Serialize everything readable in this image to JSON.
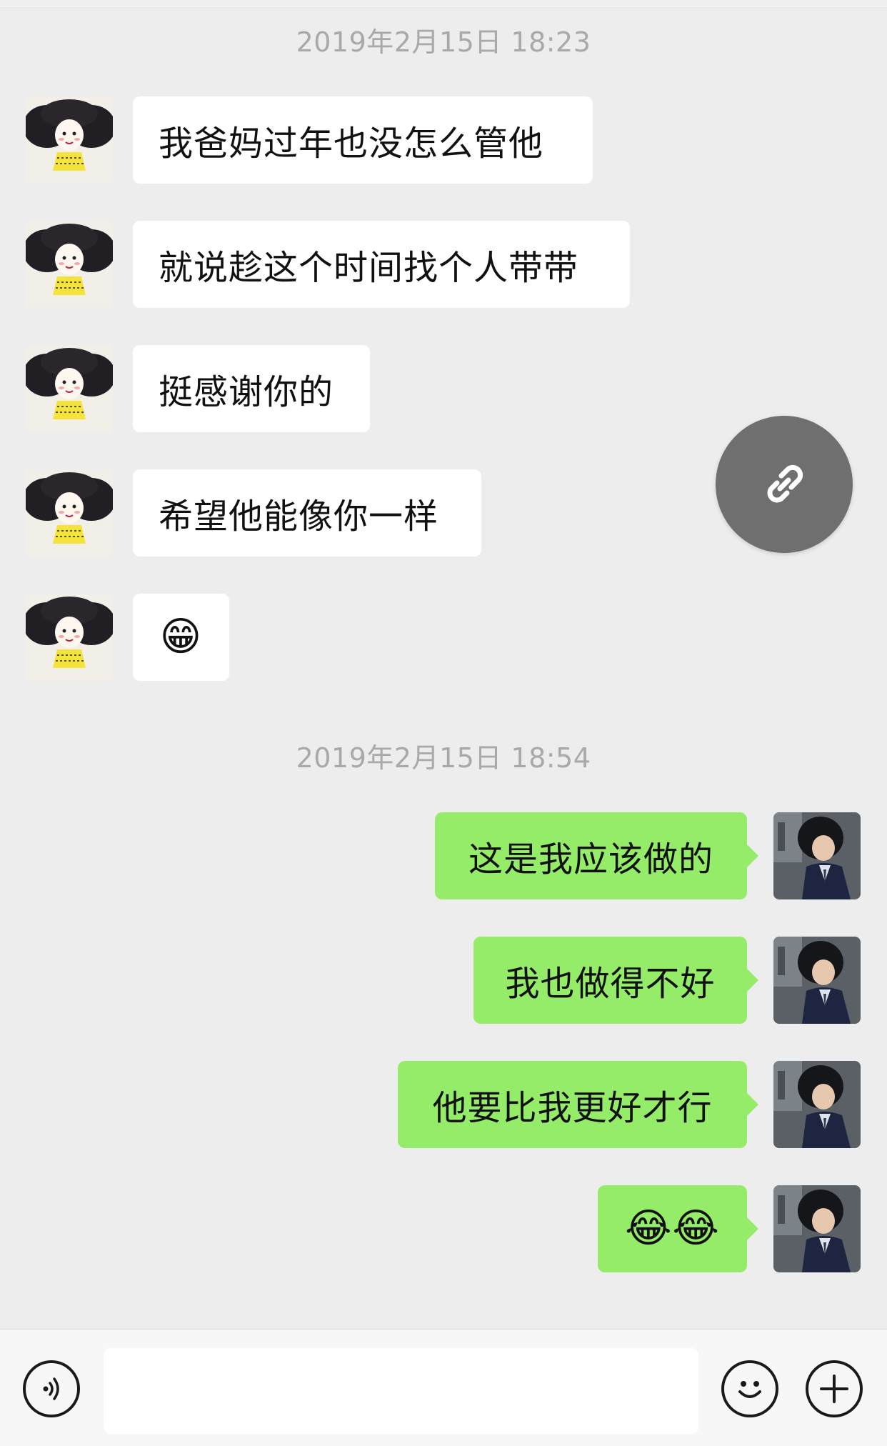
{
  "chat": {
    "timestamps": [
      "2019年2月15日 18:23",
      "2019年2月15日 18:54"
    ],
    "incoming": [
      "我爸妈过年也没怎么管他",
      "就说趁这个时间找个人带带",
      "挺感谢你的",
      "希望他能像你一样",
      "😁"
    ],
    "outgoing": [
      "这是我应该做的",
      "我也做得不好",
      "他要比我更好才行",
      "😂😂"
    ]
  },
  "floating": {
    "icon": "link-icon",
    "color": "#6f6f6f"
  },
  "input_bar": {
    "voice_icon": "voice-icon",
    "emoji_icon": "emoji-icon",
    "plus_icon": "plus-icon",
    "value": ""
  },
  "colors": {
    "background": "#ededed",
    "incoming_bubble": "#ffffff",
    "outgoing_bubble": "#95ec69"
  }
}
